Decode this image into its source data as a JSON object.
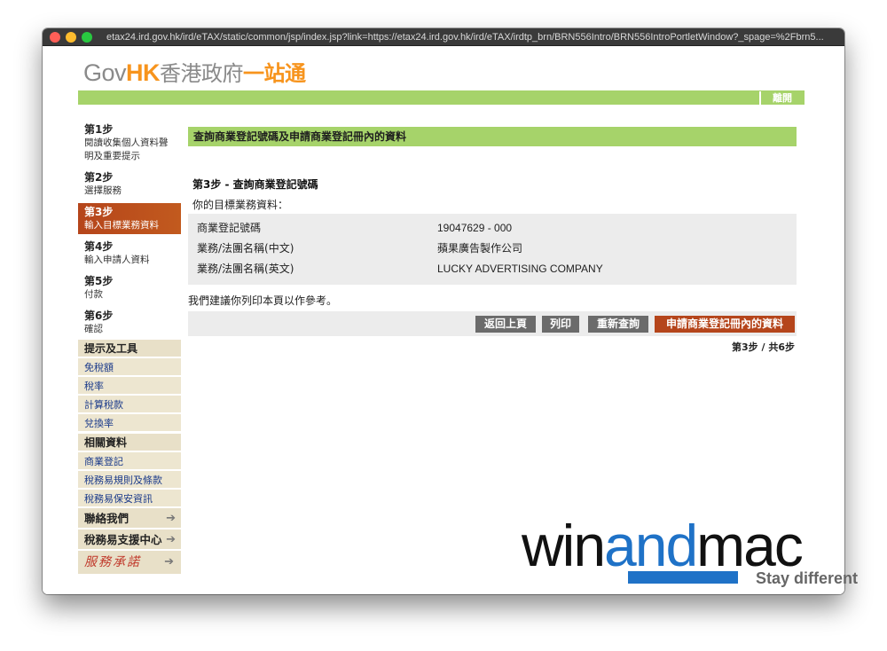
{
  "browser": {
    "url": "etax24.ird.gov.hk/ird/eTAX/static/common/jsp/index.jsp?link=https://etax24.ird.gov.hk/ird/eTAX/irdtp_brn/BRN556Intro/BRN556IntroPortletWindow?_spage=%2Fbrn5..."
  },
  "header": {
    "logo_gov": "Gov",
    "logo_hk": "HK",
    "logo_zh1": "香港政府",
    "logo_zh2": "一站通",
    "leave_label": "離開"
  },
  "sidebar": {
    "steps": [
      {
        "num": "第1步",
        "desc": "閱讀收集個人資料聲明及重要提示"
      },
      {
        "num": "第2步",
        "desc": "選擇服務"
      },
      {
        "num": "第3步",
        "desc": "輸入目標業務資料"
      },
      {
        "num": "第4步",
        "desc": "輸入申請人資料"
      },
      {
        "num": "第5步",
        "desc": "付款"
      },
      {
        "num": "第6步",
        "desc": "確認"
      }
    ],
    "tools_heading": "提示及工具",
    "tools": [
      "免稅額",
      "稅率",
      "計算稅款",
      "兌換率"
    ],
    "related_heading": "相關資料",
    "related": [
      "商業登記",
      "稅務易規則及條款",
      "稅務易保安資訊"
    ],
    "contact_label": "聯絡我們",
    "support_label": "稅務易支援中心",
    "pledge_label": "服務承諾",
    "arrow": "➔"
  },
  "main": {
    "title": "查詢商業登記號碼及申請商業登記冊內的資料",
    "step_heading": "第3步 - 查詢商業登記號碼",
    "info_label": "你的目標業務資料：",
    "rows": [
      {
        "key": "商業登記號碼",
        "value": "19047629 - 000"
      },
      {
        "key": "業務/法團名稱(中文)",
        "value": "蘋果廣告製作公司"
      },
      {
        "key": "業務/法團名稱(英文)",
        "value": "LUCKY ADVERTISING COMPANY"
      }
    ],
    "suggest": "我們建議你列印本頁以作參考。",
    "buttons": {
      "back": "返回上頁",
      "print": "列印",
      "requery": "重新查詢",
      "apply": "申請商業登記冊內的資料"
    },
    "step_count": "第3步 / 共6步"
  },
  "watermark": {
    "win": "win",
    "and": "and",
    "mac": "mac",
    "tagline": "Stay different"
  }
}
